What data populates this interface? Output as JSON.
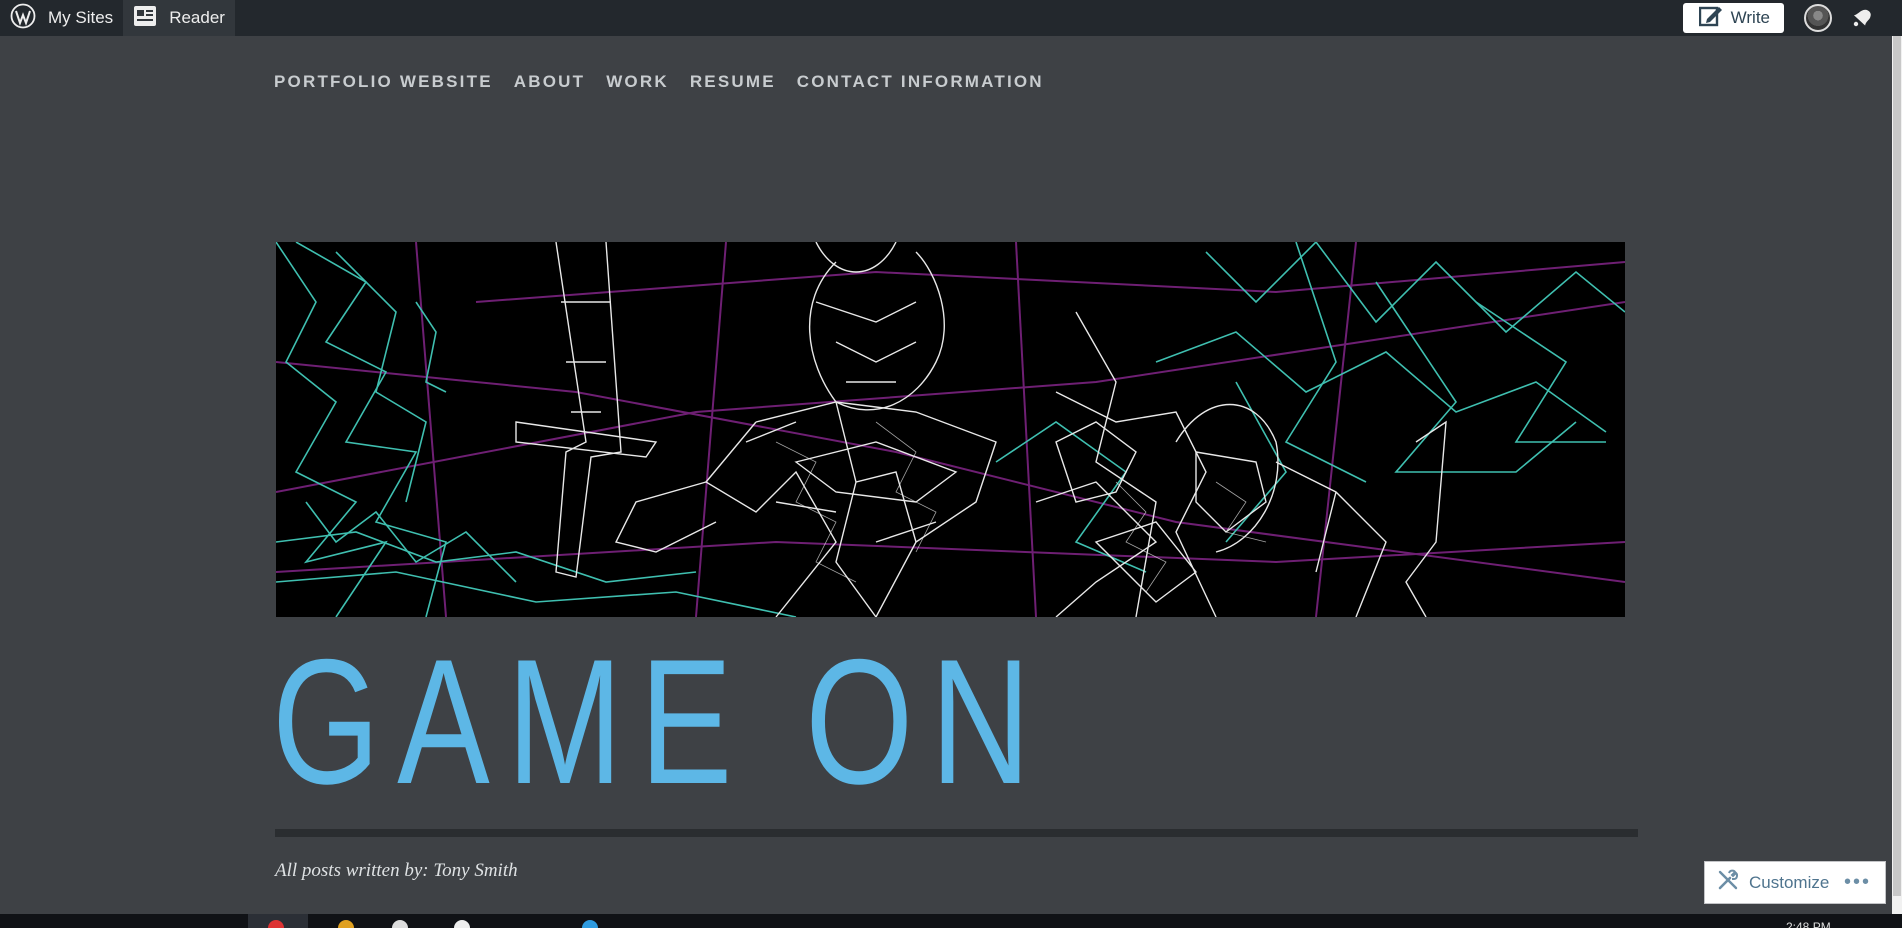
{
  "adminbar": {
    "my_sites_label": "My Sites",
    "reader_label": "Reader",
    "write_label": "Write"
  },
  "nav": {
    "items": [
      "PORTFOLIO WEBSITE",
      "ABOUT",
      "WORK",
      "RESUME",
      "CONTACT INFORMATION"
    ]
  },
  "site": {
    "title": "GAME ON",
    "byline": "All posts written by: Tony Smith"
  },
  "customizer": {
    "label": "Customize",
    "more": "•••"
  },
  "taskbar": {
    "clock": "2:48 PM"
  },
  "colors": {
    "adminbar_bg": "#23282d",
    "page_bg": "#3e4145",
    "title_blue": "#5db7e6",
    "wireframe_teal": "#3fbfb0",
    "wireframe_white": "#e8e8e8",
    "wireframe_purple": "#8a2a8c"
  }
}
